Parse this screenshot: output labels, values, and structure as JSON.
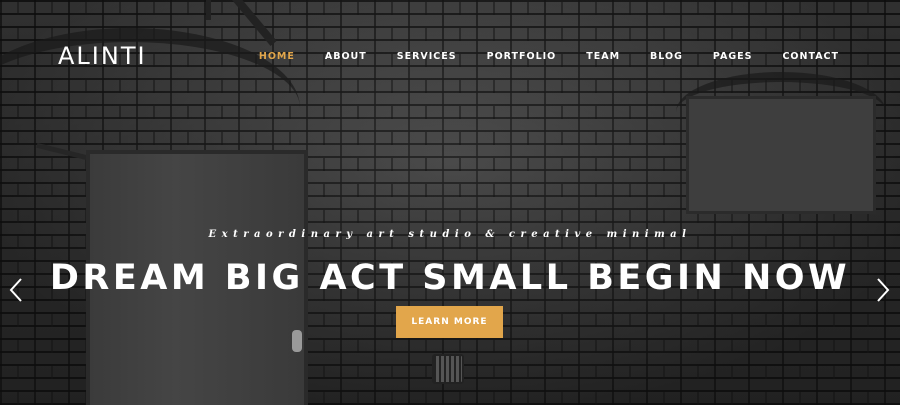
{
  "brand": {
    "logo_text": "ALINTI"
  },
  "nav": {
    "items": [
      {
        "label": "HOME",
        "active": true
      },
      {
        "label": "ABOUT",
        "active": false
      },
      {
        "label": "SERVICES",
        "active": false
      },
      {
        "label": "PORTFOLIO",
        "active": false
      },
      {
        "label": "TEAM",
        "active": false
      },
      {
        "label": "BLOG",
        "active": false
      },
      {
        "label": "PAGES",
        "active": false
      },
      {
        "label": "CONTACT",
        "active": false
      }
    ]
  },
  "hero": {
    "tagline": "Extraordinary art studio & creative minimal",
    "headline": "DREAM BIG ACT SMALL BEGIN NOW",
    "cta_label": "LEARN MORE"
  },
  "slider": {
    "prev_icon": "chevron-left-icon",
    "next_icon": "chevron-right-icon"
  },
  "colors": {
    "accent": "#e2a64b",
    "text": "#ffffff",
    "background": "#3a3a3a"
  }
}
